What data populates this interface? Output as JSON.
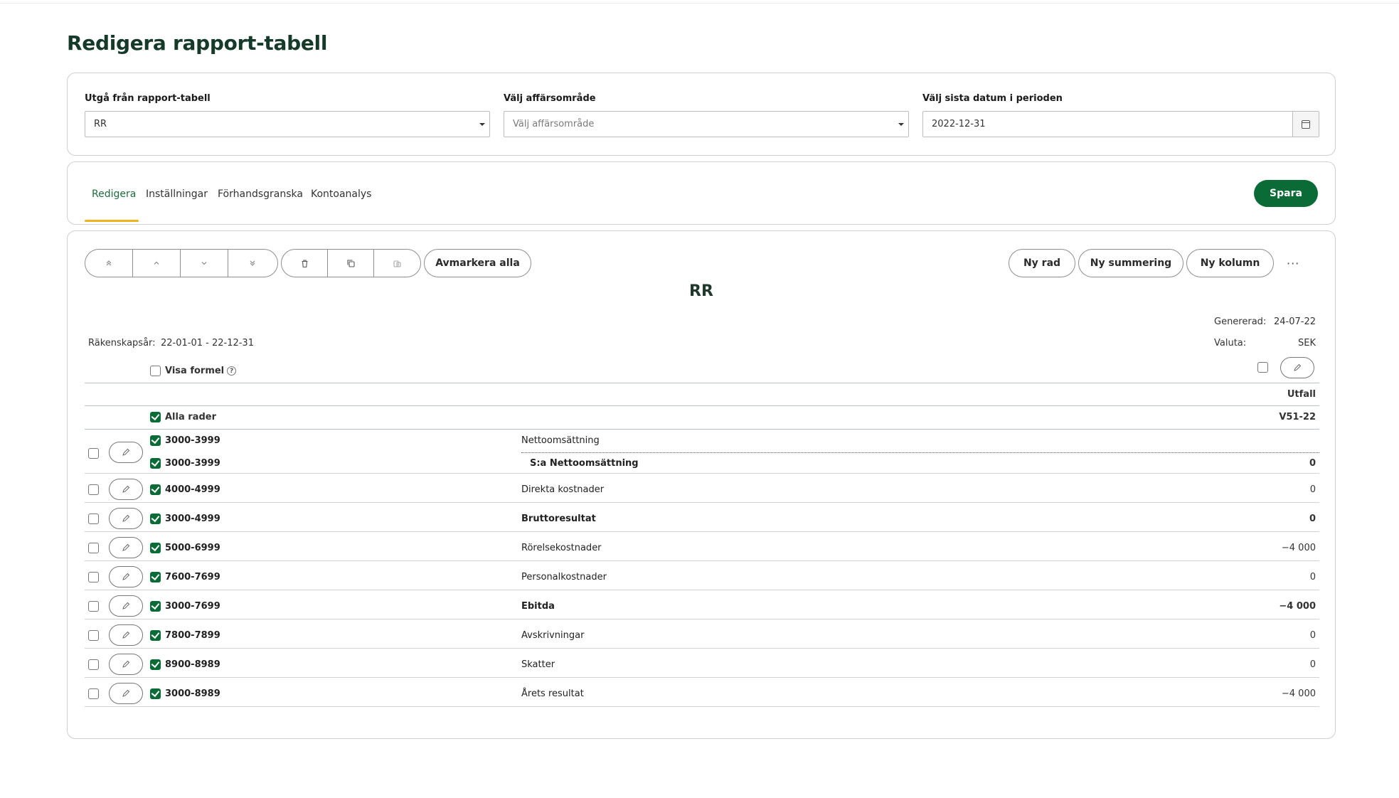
{
  "page_title": "Redigera rapport-tabell",
  "filters": {
    "report_table": {
      "label": "Utgå från rapport-tabell",
      "value": "RR"
    },
    "business_area": {
      "label": "Välj affärsområde",
      "placeholder": "Välj affärsområde"
    },
    "end_date": {
      "label": "Välj sista datum i perioden",
      "value": "2022-12-31"
    }
  },
  "tabs": [
    {
      "label": "Redigera",
      "active": true
    },
    {
      "label": "Inställningar",
      "active": false
    },
    {
      "label": "Förhandsgranska",
      "active": false
    },
    {
      "label": "Kontoanalys",
      "active": false
    }
  ],
  "save_label": "Spara",
  "toolbar": {
    "move_icons": [
      "move-top-icon",
      "move-up-icon",
      "move-down-icon",
      "move-bottom-icon"
    ],
    "action_icons": [
      "trash-icon",
      "copy-icon",
      "paste-icon"
    ],
    "deselect_all": "Avmarkera alla",
    "new_row": "Ny rad",
    "new_sum": "Ny summering",
    "new_column": "Ny kolumn",
    "more": "···"
  },
  "report": {
    "title": "RR",
    "generated_label": "Genererad:",
    "generated_value": "24-07-22",
    "fiscal_year_label": "Räkenskapsår:",
    "fiscal_year_value": "22-01-01 - 22-12-31",
    "currency_label": "Valuta:",
    "currency_value": "SEK",
    "show_formula": "Visa formel",
    "column_header": "Utfall",
    "all_rows": "Alla rader",
    "column_period": "V51-22"
  },
  "rows": [
    {
      "account": "3000-3999",
      "label": "Nettoomsättning",
      "value": "",
      "bold": false
    },
    {
      "account": "3000-3999",
      "label": "S:a Nettoomsättning",
      "value": "0",
      "bold": true
    },
    {
      "account": "4000-4999",
      "label": "Direkta kostnader",
      "value": "0",
      "bold": false
    },
    {
      "account": "3000-4999",
      "label": "Bruttoresultat",
      "value": "0",
      "bold": true
    },
    {
      "account": "5000-6999",
      "label": "Rörelsekostnader",
      "value": "−4 000",
      "bold": false
    },
    {
      "account": "7600-7699",
      "label": "Personalkostnader",
      "value": "0",
      "bold": false
    },
    {
      "account": "3000-7699",
      "label": "Ebitda",
      "value": "−4 000",
      "bold": true
    },
    {
      "account": "7800-7899",
      "label": "Avskrivningar",
      "value": "0",
      "bold": false
    },
    {
      "account": "8900-8989",
      "label": "Skatter",
      "value": "0",
      "bold": false
    },
    {
      "account": "3000-8989",
      "label": "Årets resultat",
      "value": "−4 000",
      "bold": false
    }
  ],
  "colors": {
    "primary": "#0b6b36",
    "tab_indicator": "#f0b31f",
    "title": "#163a2a"
  }
}
